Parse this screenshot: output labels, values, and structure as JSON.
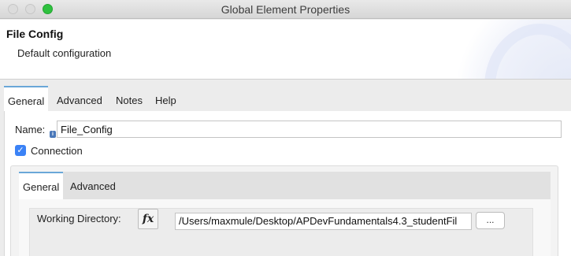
{
  "window": {
    "title": "Global Element Properties",
    "buttons": [
      "close",
      "minimize",
      "maximize"
    ]
  },
  "header": {
    "title": "File Config",
    "subtitle": "Default configuration"
  },
  "tabs": [
    {
      "label": "General",
      "active": true
    },
    {
      "label": "Advanced",
      "active": false
    },
    {
      "label": "Notes",
      "active": false
    },
    {
      "label": "Help",
      "active": false
    }
  ],
  "form": {
    "name_label": "Name:",
    "name_value": "File_Config",
    "info_icon": "i",
    "connection_label": "Connection",
    "connection_checked": true
  },
  "connection": {
    "tabs": [
      {
        "label": "General",
        "active": true
      },
      {
        "label": "Advanced",
        "active": false
      }
    ],
    "working_directory_label": "Working Directory:",
    "fx_label": "fx",
    "working_directory_value": "/Users/maxmule/Desktop/APDevFundamentals4.3_studentFil",
    "browse_label": "..."
  },
  "colors": {
    "accent": "#3b82f6",
    "tab_indicator": "#6aa7d8",
    "maximize": "#2fc13f"
  }
}
